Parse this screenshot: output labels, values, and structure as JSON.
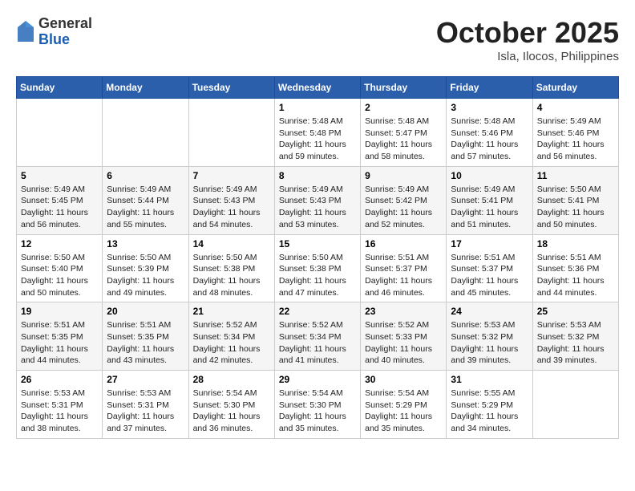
{
  "header": {
    "logo_general": "General",
    "logo_blue": "Blue",
    "month_title": "October 2025",
    "location": "Isla, Ilocos, Philippines"
  },
  "days_of_week": [
    "Sunday",
    "Monday",
    "Tuesday",
    "Wednesday",
    "Thursday",
    "Friday",
    "Saturday"
  ],
  "weeks": [
    [
      {
        "day": "",
        "info": ""
      },
      {
        "day": "",
        "info": ""
      },
      {
        "day": "",
        "info": ""
      },
      {
        "day": "1",
        "info": "Sunrise: 5:48 AM\nSunset: 5:48 PM\nDaylight: 11 hours\nand 59 minutes."
      },
      {
        "day": "2",
        "info": "Sunrise: 5:48 AM\nSunset: 5:47 PM\nDaylight: 11 hours\nand 58 minutes."
      },
      {
        "day": "3",
        "info": "Sunrise: 5:48 AM\nSunset: 5:46 PM\nDaylight: 11 hours\nand 57 minutes."
      },
      {
        "day": "4",
        "info": "Sunrise: 5:49 AM\nSunset: 5:46 PM\nDaylight: 11 hours\nand 56 minutes."
      }
    ],
    [
      {
        "day": "5",
        "info": "Sunrise: 5:49 AM\nSunset: 5:45 PM\nDaylight: 11 hours\nand 56 minutes."
      },
      {
        "day": "6",
        "info": "Sunrise: 5:49 AM\nSunset: 5:44 PM\nDaylight: 11 hours\nand 55 minutes."
      },
      {
        "day": "7",
        "info": "Sunrise: 5:49 AM\nSunset: 5:43 PM\nDaylight: 11 hours\nand 54 minutes."
      },
      {
        "day": "8",
        "info": "Sunrise: 5:49 AM\nSunset: 5:43 PM\nDaylight: 11 hours\nand 53 minutes."
      },
      {
        "day": "9",
        "info": "Sunrise: 5:49 AM\nSunset: 5:42 PM\nDaylight: 11 hours\nand 52 minutes."
      },
      {
        "day": "10",
        "info": "Sunrise: 5:49 AM\nSunset: 5:41 PM\nDaylight: 11 hours\nand 51 minutes."
      },
      {
        "day": "11",
        "info": "Sunrise: 5:50 AM\nSunset: 5:41 PM\nDaylight: 11 hours\nand 50 minutes."
      }
    ],
    [
      {
        "day": "12",
        "info": "Sunrise: 5:50 AM\nSunset: 5:40 PM\nDaylight: 11 hours\nand 50 minutes."
      },
      {
        "day": "13",
        "info": "Sunrise: 5:50 AM\nSunset: 5:39 PM\nDaylight: 11 hours\nand 49 minutes."
      },
      {
        "day": "14",
        "info": "Sunrise: 5:50 AM\nSunset: 5:38 PM\nDaylight: 11 hours\nand 48 minutes."
      },
      {
        "day": "15",
        "info": "Sunrise: 5:50 AM\nSunset: 5:38 PM\nDaylight: 11 hours\nand 47 minutes."
      },
      {
        "day": "16",
        "info": "Sunrise: 5:51 AM\nSunset: 5:37 PM\nDaylight: 11 hours\nand 46 minutes."
      },
      {
        "day": "17",
        "info": "Sunrise: 5:51 AM\nSunset: 5:37 PM\nDaylight: 11 hours\nand 45 minutes."
      },
      {
        "day": "18",
        "info": "Sunrise: 5:51 AM\nSunset: 5:36 PM\nDaylight: 11 hours\nand 44 minutes."
      }
    ],
    [
      {
        "day": "19",
        "info": "Sunrise: 5:51 AM\nSunset: 5:35 PM\nDaylight: 11 hours\nand 44 minutes."
      },
      {
        "day": "20",
        "info": "Sunrise: 5:51 AM\nSunset: 5:35 PM\nDaylight: 11 hours\nand 43 minutes."
      },
      {
        "day": "21",
        "info": "Sunrise: 5:52 AM\nSunset: 5:34 PM\nDaylight: 11 hours\nand 42 minutes."
      },
      {
        "day": "22",
        "info": "Sunrise: 5:52 AM\nSunset: 5:34 PM\nDaylight: 11 hours\nand 41 minutes."
      },
      {
        "day": "23",
        "info": "Sunrise: 5:52 AM\nSunset: 5:33 PM\nDaylight: 11 hours\nand 40 minutes."
      },
      {
        "day": "24",
        "info": "Sunrise: 5:53 AM\nSunset: 5:32 PM\nDaylight: 11 hours\nand 39 minutes."
      },
      {
        "day": "25",
        "info": "Sunrise: 5:53 AM\nSunset: 5:32 PM\nDaylight: 11 hours\nand 39 minutes."
      }
    ],
    [
      {
        "day": "26",
        "info": "Sunrise: 5:53 AM\nSunset: 5:31 PM\nDaylight: 11 hours\nand 38 minutes."
      },
      {
        "day": "27",
        "info": "Sunrise: 5:53 AM\nSunset: 5:31 PM\nDaylight: 11 hours\nand 37 minutes."
      },
      {
        "day": "28",
        "info": "Sunrise: 5:54 AM\nSunset: 5:30 PM\nDaylight: 11 hours\nand 36 minutes."
      },
      {
        "day": "29",
        "info": "Sunrise: 5:54 AM\nSunset: 5:30 PM\nDaylight: 11 hours\nand 35 minutes."
      },
      {
        "day": "30",
        "info": "Sunrise: 5:54 AM\nSunset: 5:29 PM\nDaylight: 11 hours\nand 35 minutes."
      },
      {
        "day": "31",
        "info": "Sunrise: 5:55 AM\nSunset: 5:29 PM\nDaylight: 11 hours\nand 34 minutes."
      },
      {
        "day": "",
        "info": ""
      }
    ]
  ]
}
